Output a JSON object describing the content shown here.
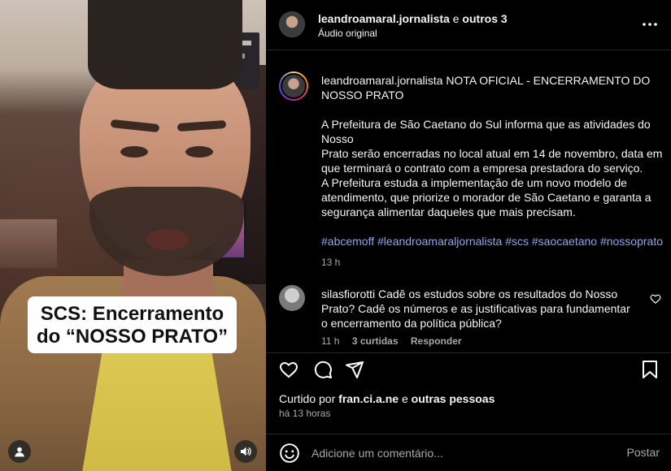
{
  "colors": {
    "background": "#000000",
    "text": "#f5f5f5",
    "muted": "#a8a8a8",
    "hashtag": "#8fa6f0",
    "divider": "#262626",
    "caption_box": "#ffffff"
  },
  "media": {
    "caption_line1": "SCS: Encerramento",
    "caption_line2": "do “NOSSO PRATO”",
    "user_button_icon": "user-icon",
    "sound_button_icon": "speaker-icon"
  },
  "header": {
    "username": "leandroamaral.jornalista",
    "connector": " e ",
    "others": "outros 3",
    "audio": "Áudio original",
    "more_icon": "more-horizontal-icon"
  },
  "post": {
    "username": "leandroamaral.jornalista",
    "title": "NOTA OFICIAL - ENCERRAMENTO DO NOSSO PRATO",
    "paragraph1_line1": "A Prefeitura de São Caetano do Sul informa que as atividades do Nosso",
    "paragraph1_line2": "Prato serão encerradas no local atual em 14 de novembro, data em que terminará o contrato com a empresa prestadora do serviço.",
    "paragraph2": "A Prefeitura estuda a implementação de um novo modelo de atendimento, que priorize o morador de São Caetano e garanta a segurança alimentar daqueles que mais precisam.",
    "hashtags": "#abcemoff #leandroamaraljornalista #scs #saocaetano #nossoprato",
    "time": "13 h"
  },
  "comment": {
    "username": "silasfiorotti",
    "text": "Cadê os estudos sobre os resultados do Nosso Prato? Cadê os números e as justificativas para fundamentar o encerramento da política pública?",
    "time": "11 h",
    "likes": "3 curtidas",
    "reply": "Responder"
  },
  "actions": {
    "like_icon": "heart-icon",
    "comment_icon": "comment-icon",
    "share_icon": "send-icon",
    "save_icon": "bookmark-icon"
  },
  "likes": {
    "prefix": "Curtido por ",
    "user": "fran.ci.a.ne",
    "connector": " e ",
    "others": "outras pessoas",
    "ago": "há 13 horas"
  },
  "add_comment": {
    "placeholder": "Adicione um comentário...",
    "post_label": "Postar"
  }
}
